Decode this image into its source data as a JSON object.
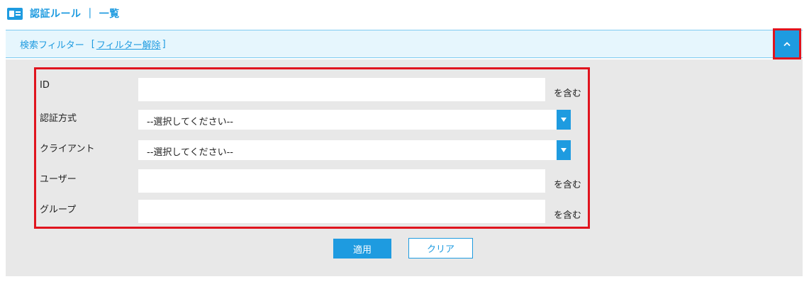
{
  "header": {
    "title": "認証ルール ｜ 一覧",
    "icon": "id-card-icon"
  },
  "filter": {
    "label": "検索フィルター",
    "bracket_open": "[",
    "clear_link": "フィルター解除",
    "bracket_close": "]",
    "collapse_icon": "chevron-up-icon"
  },
  "fields": {
    "id": {
      "label": "ID",
      "value": "",
      "suffix": "を含む"
    },
    "auth_method": {
      "label": "認証方式",
      "selected": "--選択してください--"
    },
    "client": {
      "label": "クライアント",
      "selected": "--選択してください--"
    },
    "user": {
      "label": "ユーザー",
      "value": "",
      "suffix": "を含む"
    },
    "group": {
      "label": "グループ",
      "value": "",
      "suffix": "を含む"
    }
  },
  "buttons": {
    "apply": "適用",
    "clear": "クリア"
  },
  "colors": {
    "accent": "#1e9be0",
    "highlight": "#e0141e",
    "panel": "#e8e8e8",
    "filter_bar": "#e6f6fd"
  }
}
